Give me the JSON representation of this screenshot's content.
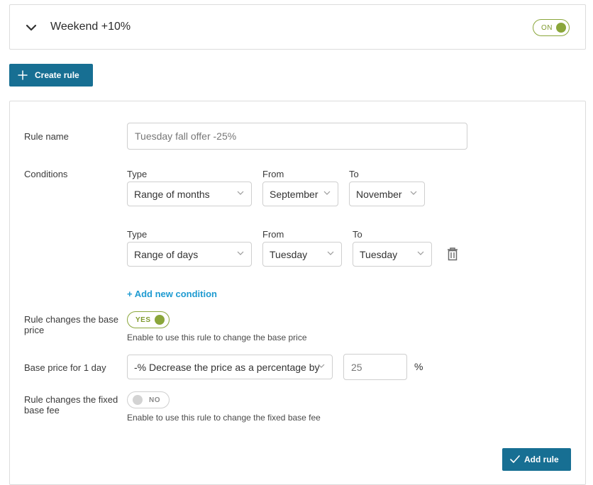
{
  "top_rule": {
    "title": "Weekend +10%",
    "toggle_label": "ON"
  },
  "create_button": {
    "label": "Create rule"
  },
  "form": {
    "rule_name_label": "Rule name",
    "rule_name_value": "Tuesday fall offer -25%",
    "conditions_label": "Conditions",
    "conditions": [
      {
        "type_label": "Type",
        "type_value": "Range of months",
        "from_label": "From",
        "from_value": "September",
        "to_label": "To",
        "to_value": "November"
      },
      {
        "type_label": "Type",
        "type_value": "Range of days",
        "from_label": "From",
        "from_value": "Tuesday",
        "to_label": "To",
        "to_value": "Tuesday"
      }
    ],
    "add_condition_label": "+ Add new condition",
    "base_price_change_label": "Rule changes the base price",
    "base_price_toggle_label": "YES",
    "base_price_hint": "Enable to use this rule to change the base price",
    "base_price_1day_label": "Base price for 1 day",
    "base_price_mode_value": "-% Decrease the price as a percentage by",
    "base_price_amount_value": "25",
    "percent_unit": "%",
    "fixed_fee_change_label": "Rule changes the fixed base fee",
    "fixed_fee_toggle_label": "NO",
    "fixed_fee_hint": "Enable to use this rule to change the fixed base fee",
    "add_rule_label": "Add rule"
  },
  "colors": {
    "primary": "#176f93",
    "toggle_on": "#8aa63a",
    "link": "#1f9bd1"
  }
}
